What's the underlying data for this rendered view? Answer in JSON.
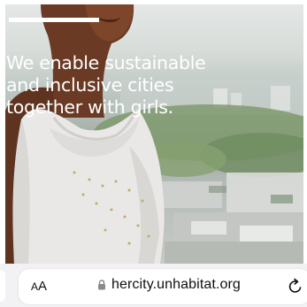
{
  "hero": {
    "headline_lines": [
      "We enable sustainable",
      "and inclusive cities",
      "together with girls."
    ]
  },
  "browser": {
    "text_size_label": "AA",
    "url": "hercity.unhabitat.org",
    "icons": {
      "lock": "lock-icon",
      "reload": "reload-icon"
    }
  }
}
